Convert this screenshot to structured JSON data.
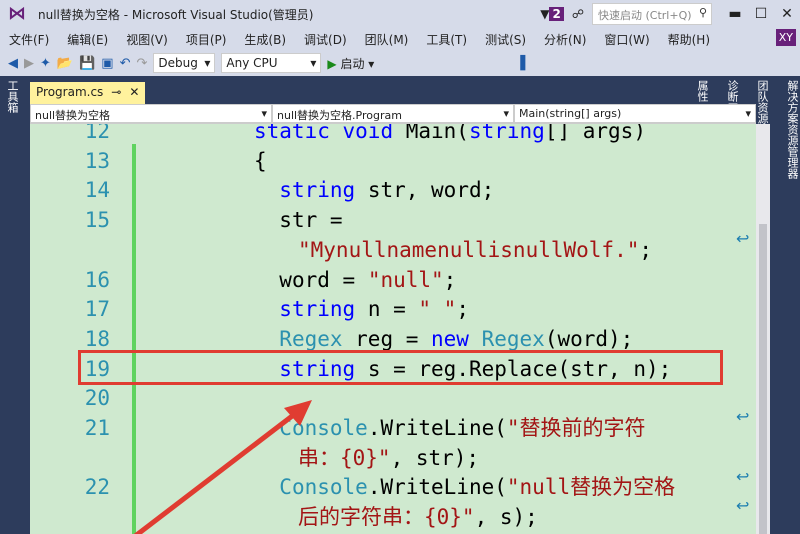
{
  "window": {
    "title": "null替换为空格 - Microsoft Visual Studio(管理员)",
    "notification_count": "2",
    "quick_launch_placeholder": "快速启动 (Ctrl+Q)",
    "avatar": "XY"
  },
  "menu": [
    "文件(F)",
    "编辑(E)",
    "视图(V)",
    "项目(P)",
    "生成(B)",
    "调试(D)",
    "团队(M)",
    "工具(T)",
    "测试(S)",
    "分析(N)",
    "窗口(W)",
    "帮助(H)"
  ],
  "toolbar": {
    "config": "Debug",
    "platform": "Any CPU",
    "start": "启动"
  },
  "left_panel": "工具箱",
  "right_panels": [
    "解决方案资源管理器",
    "团队资源管理器",
    "诊断工具",
    "属性"
  ],
  "tab": {
    "name": "Program.cs"
  },
  "nav": {
    "project": "null替换为空格",
    "class": "null替换为空格.Program",
    "member": "Main(string[] args)"
  },
  "code_lines": [
    {
      "n": "12",
      "parts": [
        [
          "kw",
          "static "
        ],
        [
          "kw",
          "void "
        ],
        [
          "",
          "Main("
        ],
        [
          "kw",
          "string"
        ],
        [
          "",
          "[] args)"
        ]
      ]
    },
    {
      "n": "13",
      "parts": [
        [
          "",
          "{"
        ]
      ]
    },
    {
      "n": "14",
      "parts": [
        [
          "    ",
          ""
        ],
        [
          "kw",
          "string "
        ],
        [
          "",
          "str, word;"
        ]
      ]
    },
    {
      "n": "15",
      "parts": [
        [
          "    ",
          ""
        ],
        [
          "",
          "str ="
        ]
      ]
    },
    {
      "n": "",
      "parts": [
        [
          "st",
          "\"MynullnamenullisnullWolf.\""
        ],
        [
          "",
          ";"
        ]
      ],
      "wrap": true
    },
    {
      "n": "16",
      "parts": [
        [
          "    ",
          ""
        ],
        [
          "",
          "word = "
        ],
        [
          "st",
          "\"null\""
        ],
        [
          "",
          ";"
        ]
      ]
    },
    {
      "n": "17",
      "parts": [
        [
          "    ",
          ""
        ],
        [
          "kw",
          "string "
        ],
        [
          "",
          "n = "
        ],
        [
          "st",
          "\" \""
        ],
        [
          "",
          ";"
        ]
      ]
    },
    {
      "n": "18",
      "parts": [
        [
          "    ",
          ""
        ],
        [
          "ty",
          "Regex "
        ],
        [
          "",
          "reg = "
        ],
        [
          "kw",
          "new "
        ],
        [
          "ty",
          "Regex"
        ],
        [
          "",
          "(word);"
        ]
      ]
    },
    {
      "n": "19",
      "parts": [
        [
          "    ",
          ""
        ],
        [
          "kw",
          "string "
        ],
        [
          "",
          "s = reg.Replace(str, n);"
        ]
      ]
    },
    {
      "n": "20",
      "parts": []
    },
    {
      "n": "21",
      "parts": [
        [
          "    ",
          ""
        ],
        [
          "ty",
          "Console"
        ],
        [
          "",
          ".WriteLine("
        ],
        [
          "st",
          "\"替换前的字符"
        ]
      ]
    },
    {
      "n": "",
      "parts": [
        [
          "st",
          "串：{0}\""
        ],
        [
          "",
          ", str);"
        ]
      ],
      "wrap": true
    },
    {
      "n": "22",
      "parts": [
        [
          "    ",
          ""
        ],
        [
          "ty",
          "Console"
        ],
        [
          "",
          ".WriteLine("
        ],
        [
          "st",
          "\"null替换为空格"
        ]
      ]
    },
    {
      "n": "",
      "parts": [
        [
          "st",
          "后的字符串：{0}\""
        ],
        [
          "",
          ", s);"
        ]
      ],
      "wrap": true
    }
  ]
}
